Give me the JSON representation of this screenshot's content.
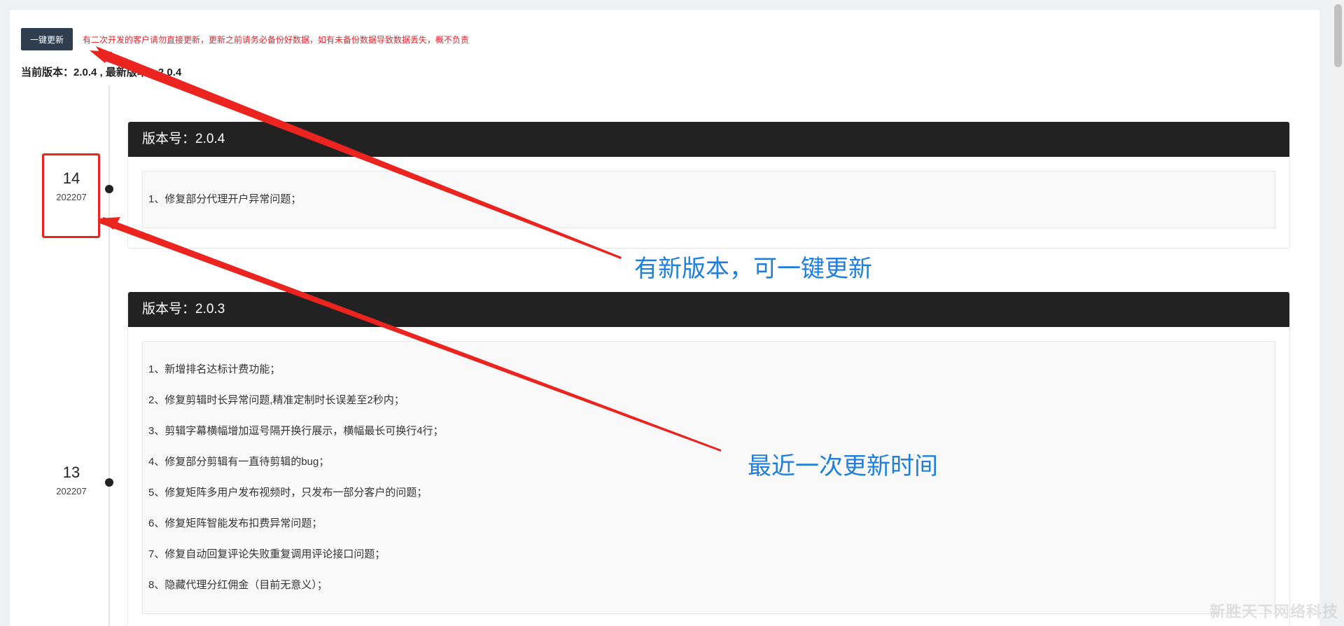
{
  "toolbar": {
    "update_label": "一键更新",
    "warning": "有二次开发的客户请勿直接更新，更新之前请务必备份好数据，如有未备份数据导致数据丢失，概不负责"
  },
  "version_info": {
    "current_label": "当前版本：",
    "current_value": "2.0.4",
    "separator": " , ",
    "latest_label": "最新版本：",
    "latest_value": "2.0.4"
  },
  "timeline": [
    {
      "day": "14",
      "yearmonth": "202207",
      "version_title": "版本号：2.0.4",
      "notes": [
        "1、修复部分代理开户异常问题；"
      ]
    },
    {
      "day": "13",
      "yearmonth": "202207",
      "version_title": "版本号：2.0.3",
      "notes": [
        "1、新增排名达标计费功能；",
        "2、修复剪辑时长异常问题,精准定制时长误差至2秒内；",
        "3、剪辑字幕横幅增加逗号隔开换行展示，横幅最长可换行4行；",
        "4、修复部分剪辑有一直待剪辑的bug；",
        "5、修复矩阵多用户发布视频时，只发布一部分客户的问题；",
        "6、修复矩阵智能发布扣费异常问题；",
        "7、修复自动回复评论失败重复调用评论接口问题；",
        "8、隐藏代理分红佣金（目前无意义）；"
      ]
    }
  ],
  "annotations": {
    "update_hint": "有新版本，可一键更新",
    "time_hint": "最近一次更新时间"
  },
  "watermark": "新胜天下网络科技",
  "colors": {
    "button_bg": "#2e3d4f",
    "warning_text": "#e8262d",
    "card_header_bg": "#222222",
    "annotation_text": "#1e7fe0",
    "arrow_red": "#ec2420"
  }
}
